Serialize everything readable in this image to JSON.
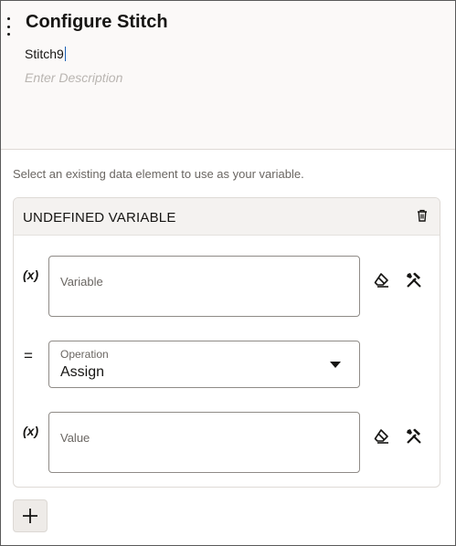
{
  "header": {
    "title": "Configure Stitch",
    "name_value": "Stitch9",
    "description_placeholder": "Enter Description"
  },
  "helper_text": "Select an existing data element to use as your variable.",
  "card": {
    "title": "UNDEFINED VARIABLE",
    "variable_row": {
      "label": "(x)",
      "placeholder": "Variable"
    },
    "operation_row": {
      "label": "=",
      "field_label": "Operation",
      "selected": "Assign"
    },
    "value_row": {
      "label": "(x)",
      "placeholder": "Value"
    }
  },
  "icons": [
    "kebab-menu-icon",
    "trash-icon",
    "eraser-icon",
    "tools-icon",
    "chevron-down-icon",
    "plus-icon"
  ]
}
